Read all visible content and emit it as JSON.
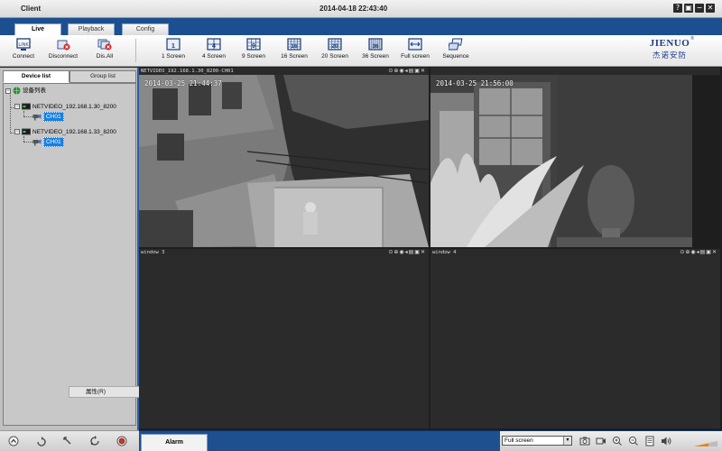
{
  "titlebar": {
    "title": "Client",
    "datetime": "2014-04-18 22:43:40",
    "buttons": [
      "?",
      "▣",
      "−",
      "✕"
    ]
  },
  "tabs": [
    {
      "label": "Live",
      "active": true
    },
    {
      "label": "Playback",
      "active": false
    },
    {
      "label": "Config",
      "active": false
    }
  ],
  "toolbar": {
    "connect": "Connect",
    "disconnect": "Disconnect",
    "dis_all": "Dis.All",
    "screens": [
      {
        "label": "1 Screen",
        "num": "1"
      },
      {
        "label": "4 Screen",
        "num": "4"
      },
      {
        "label": "9 Screen",
        "num": "9"
      },
      {
        "label": "16 Screen",
        "num": "16"
      },
      {
        "label": "20 Screen",
        "num": "20"
      },
      {
        "label": "36 Screen",
        "num": "36"
      }
    ],
    "full_screen": "Full screen",
    "sequence": "Sequence"
  },
  "logo": {
    "brand": "JIENUO",
    "subtitle": "杰诺安防",
    "reg": "®"
  },
  "leftpanel": {
    "tabs": [
      {
        "label": "Device list",
        "active": true
      },
      {
        "label": "Group list",
        "active": false
      }
    ],
    "tree": {
      "root": "设备列表",
      "devices": [
        {
          "name": "NETVIDEO_192.168.1.30_8200",
          "channel": "CH01"
        },
        {
          "name": "NETVIDEO_192.168.1.33_8200",
          "channel": "CH01"
        }
      ]
    },
    "context_menu": "属性(R)"
  },
  "windows": [
    {
      "title": "NETVIDEO_192.168.1.30_8200-CH01",
      "timestamp": "2014-03-25 21:44:37"
    },
    {
      "title": "",
      "timestamp": "2014-03-25 21:56:00"
    },
    {
      "title": "window 3",
      "timestamp": ""
    },
    {
      "title": "window 4",
      "timestamp": ""
    }
  ],
  "window_icons": "⊙⊕◉◂▤▣✕",
  "bottombar": {
    "alarm_tab": "Alarm",
    "screen_mode": "Full screen"
  },
  "colors": {
    "accent": "#1c4f8f",
    "selection": "#1b7fe0"
  }
}
